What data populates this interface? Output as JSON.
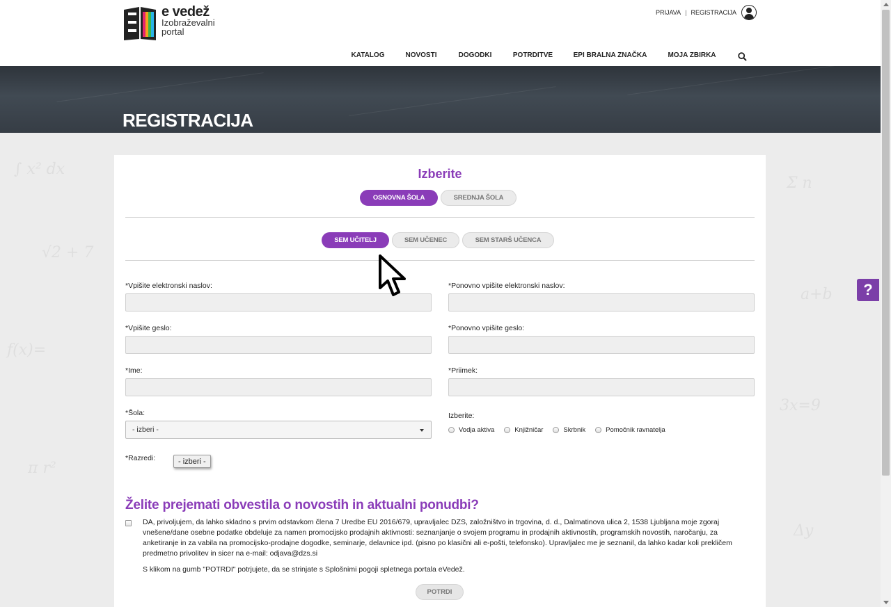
{
  "brand": {
    "title": "e vedež",
    "subtitle": "Izobraževalni portal"
  },
  "toplinks": {
    "login": "PRIJAVA",
    "separator": "|",
    "register": "REGISTRACIJA"
  },
  "nav": [
    {
      "label": "KATALOG",
      "color": "#e5236f"
    },
    {
      "label": "NOVOSTI",
      "color": "#f4a31b"
    },
    {
      "label": "DOGODKI",
      "color": "#3bb54a"
    },
    {
      "label": "POTRDITVE",
      "color": "#27b4e8"
    },
    {
      "label": "EPI BRALNA ZNAČKA",
      "color": "#1f6fb5"
    },
    {
      "label": "MOJA ZBIRKA",
      "color": "#8a3cb8"
    }
  ],
  "search": {
    "icon": "search-icon",
    "color": "#dcdcdc"
  },
  "hero": {
    "title": "REGISTRACIJA"
  },
  "form": {
    "choose_title": "Izberite",
    "school_types": [
      {
        "label": "OSNOVNA ŠOLA",
        "active": true
      },
      {
        "label": "SREDNJA ŠOLA",
        "active": false
      }
    ],
    "roles": [
      {
        "label": "SEM UČITELJ",
        "active": true
      },
      {
        "label": "SEM UČENEC",
        "active": false
      },
      {
        "label": "SEM STARŠ UČENCA",
        "active": false
      }
    ],
    "email_label": "*Vpišite elektronski naslov:",
    "email_repeat_label": "*Ponovno vpišite elektronski naslov:",
    "password_label": "*Vpišite geslo:",
    "password_repeat_label": "*Ponovno vpišite geslo:",
    "name_label": "*Ime:",
    "surname_label": "*Priimek:",
    "school_label": "*Šola:",
    "school_select": "- izberi -",
    "function_label": "Izberite:",
    "functions": [
      "Vodja aktiva",
      "Knjižničar",
      "Skrbnik",
      "Pomočnik ravnatelja"
    ],
    "classes_label": "*Razredi:",
    "classes_button": "- izberi -",
    "news_title": "Želite prejemati obvestila o novostih in aktualni ponudbi?",
    "consent_text": "DA, privoljujem, da lahko skladno s prvim odstavkom člena 7 Uredbe EU 2016/679, upravljalec DZS, založništvo in trgovina, d. d., Dalmatinova ulica 2,  1538 Ljubljana moje zgoraj vnešene/dane osebne podatke obdeluje za namen promocijsko prodajnih aktivnosti: seznanjanje o svojem programu in prodajnih aktivnostih,  programskih novostih, naročanju, za anketiranje in za vabila na promocijsko-prodajne dogodke, seminarje, delavnice ipd. (pisno po klasični ali e-pošti, telefonsko).  Upravljalec me je seznanil, da lahko kadar koli prekličem predmetno privolitev in sicer na e-mail: odjava@dzs.si",
    "terms_text": "S klikom na gumb \"POTRDI\" potrjujete, da se strinjate s Splošnimi pogoji spletnega portala eVedež.",
    "submit_label": "POTRDI"
  },
  "help": {
    "label": "?"
  },
  "colors": {
    "accent": "#8a3cb8"
  }
}
